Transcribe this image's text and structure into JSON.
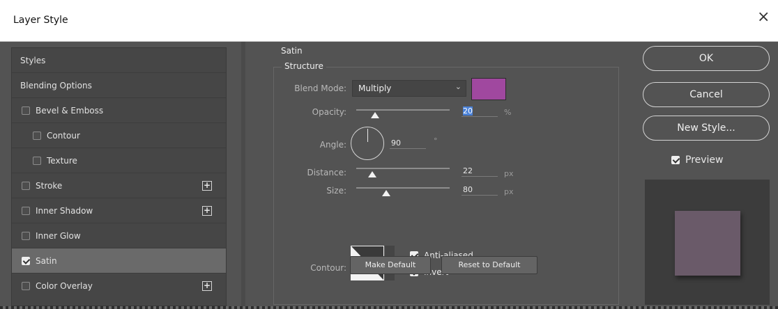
{
  "window": {
    "title": "Layer Style",
    "close_glyph": "×"
  },
  "styles_list": [
    {
      "label": "Styles",
      "checkbox": false,
      "plus": false,
      "selected": false
    },
    {
      "label": "Blending Options",
      "checkbox": false,
      "plus": false,
      "selected": false
    },
    {
      "label": "Bevel & Emboss",
      "checkbox": true,
      "checked": false,
      "plus": false,
      "selected": false
    },
    {
      "label": "Contour",
      "checkbox": true,
      "checked": false,
      "plus": false,
      "selected": false,
      "indent": true
    },
    {
      "label": "Texture",
      "checkbox": true,
      "checked": false,
      "plus": false,
      "selected": false,
      "indent": true
    },
    {
      "label": "Stroke",
      "checkbox": true,
      "checked": false,
      "plus": true,
      "selected": false
    },
    {
      "label": "Inner Shadow",
      "checkbox": true,
      "checked": false,
      "plus": true,
      "selected": false
    },
    {
      "label": "Inner Glow",
      "checkbox": true,
      "checked": false,
      "plus": false,
      "selected": false
    },
    {
      "label": "Satin",
      "checkbox": true,
      "checked": true,
      "plus": false,
      "selected": true
    },
    {
      "label": "Color Overlay",
      "checkbox": true,
      "checked": false,
      "plus": true,
      "selected": false
    }
  ],
  "satin": {
    "section_title": "Satin",
    "group_title": "Structure",
    "blend_mode": {
      "label": "Blend Mode:",
      "value": "Multiply",
      "color": "#a0489f"
    },
    "opacity": {
      "label": "Opacity:",
      "value": "20",
      "unit": "%",
      "level": 0.2
    },
    "angle": {
      "label": "Angle:",
      "value": "90",
      "unit": "°"
    },
    "distance": {
      "label": "Distance:",
      "value": "22",
      "unit": "px",
      "level": 0.17
    },
    "size": {
      "label": "Size:",
      "value": "80",
      "unit": "px",
      "level": 0.32
    },
    "contour": {
      "label": "Contour:"
    },
    "anti_aliased": {
      "label": "Anti-aliased",
      "checked": true
    },
    "invert": {
      "label": "Invert",
      "checked": true
    },
    "make_default": "Make Default",
    "reset_default": "Reset to Default"
  },
  "actions": {
    "ok": "OK",
    "cancel": "Cancel",
    "new_style": "New Style...",
    "preview": {
      "label": "Preview",
      "checked": true
    }
  },
  "colors": {
    "preview_swatch": "#6a5a69"
  }
}
